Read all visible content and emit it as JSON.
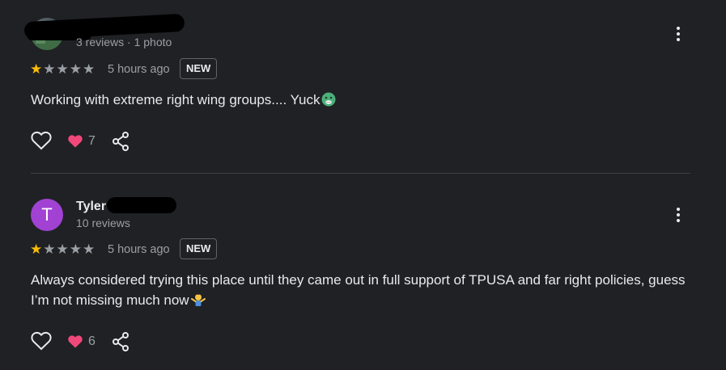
{
  "reviews": [
    {
      "author": "",
      "meta": "3 reviews · 1 photo",
      "avatar_letter": "",
      "rating": 1,
      "max_rating": 5,
      "time": "5 hours ago",
      "badge": "NEW",
      "text": "Working with extreme right wing groups.... Yuck",
      "emoji": "nauseated-face-emoji",
      "like_count": "7"
    },
    {
      "author": "Tyler",
      "meta": "10 reviews",
      "avatar_letter": "T",
      "rating": 1,
      "max_rating": 5,
      "time": "5 hours ago",
      "badge": "NEW",
      "text": "Always considered trying this place until they came out in full support of TPUSA and far right policies, guess I’m not missing much now",
      "emoji": "person-shrugging-emoji",
      "like_count": "6"
    }
  ],
  "colors": {
    "background": "#202124",
    "star_on": "#fbbc04",
    "star_off": "#9aa0a6",
    "avatar_letter_bg": "#a142d3",
    "heart": "#f0487a"
  }
}
